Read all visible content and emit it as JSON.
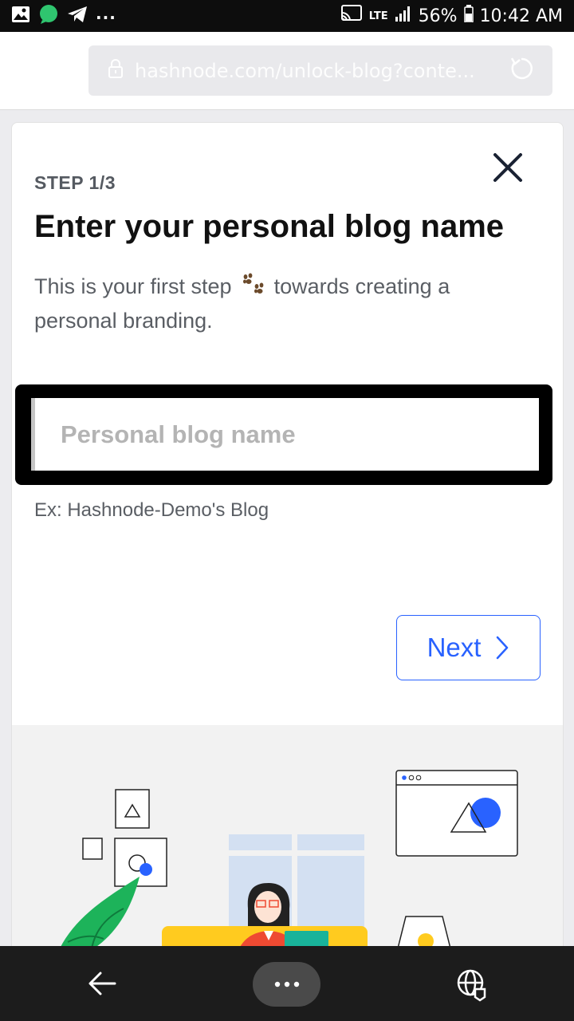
{
  "status_bar": {
    "network": "LTE",
    "battery": "56%",
    "time": "10:42 AM",
    "overflow": "..."
  },
  "browser": {
    "url": "hashnode.com/unlock-blog?conte..."
  },
  "onboarding": {
    "step_label": "STEP 1/3",
    "title": "Enter your personal blog name",
    "description_before": "This is your first step",
    "description_after": "towards creating a personal branding.",
    "input_placeholder": "Personal blog name",
    "input_value": "",
    "hint": "Ex: Hashnode-Demo's Blog",
    "next_label": "Next"
  },
  "colors": {
    "accent": "#2962ff",
    "illustration_green": "#1db35a",
    "illustration_yellow": "#ffcb1f",
    "illustration_red": "#ee4a32"
  },
  "icons": [
    "gallery-icon",
    "chat-icon",
    "telegram-icon",
    "cast-icon",
    "signal-icon",
    "battery-icon",
    "lock-icon",
    "reload-icon",
    "close-icon",
    "paw-icon",
    "chevron-right-icon",
    "back-arrow-icon",
    "more-icon",
    "globe-icon"
  ]
}
